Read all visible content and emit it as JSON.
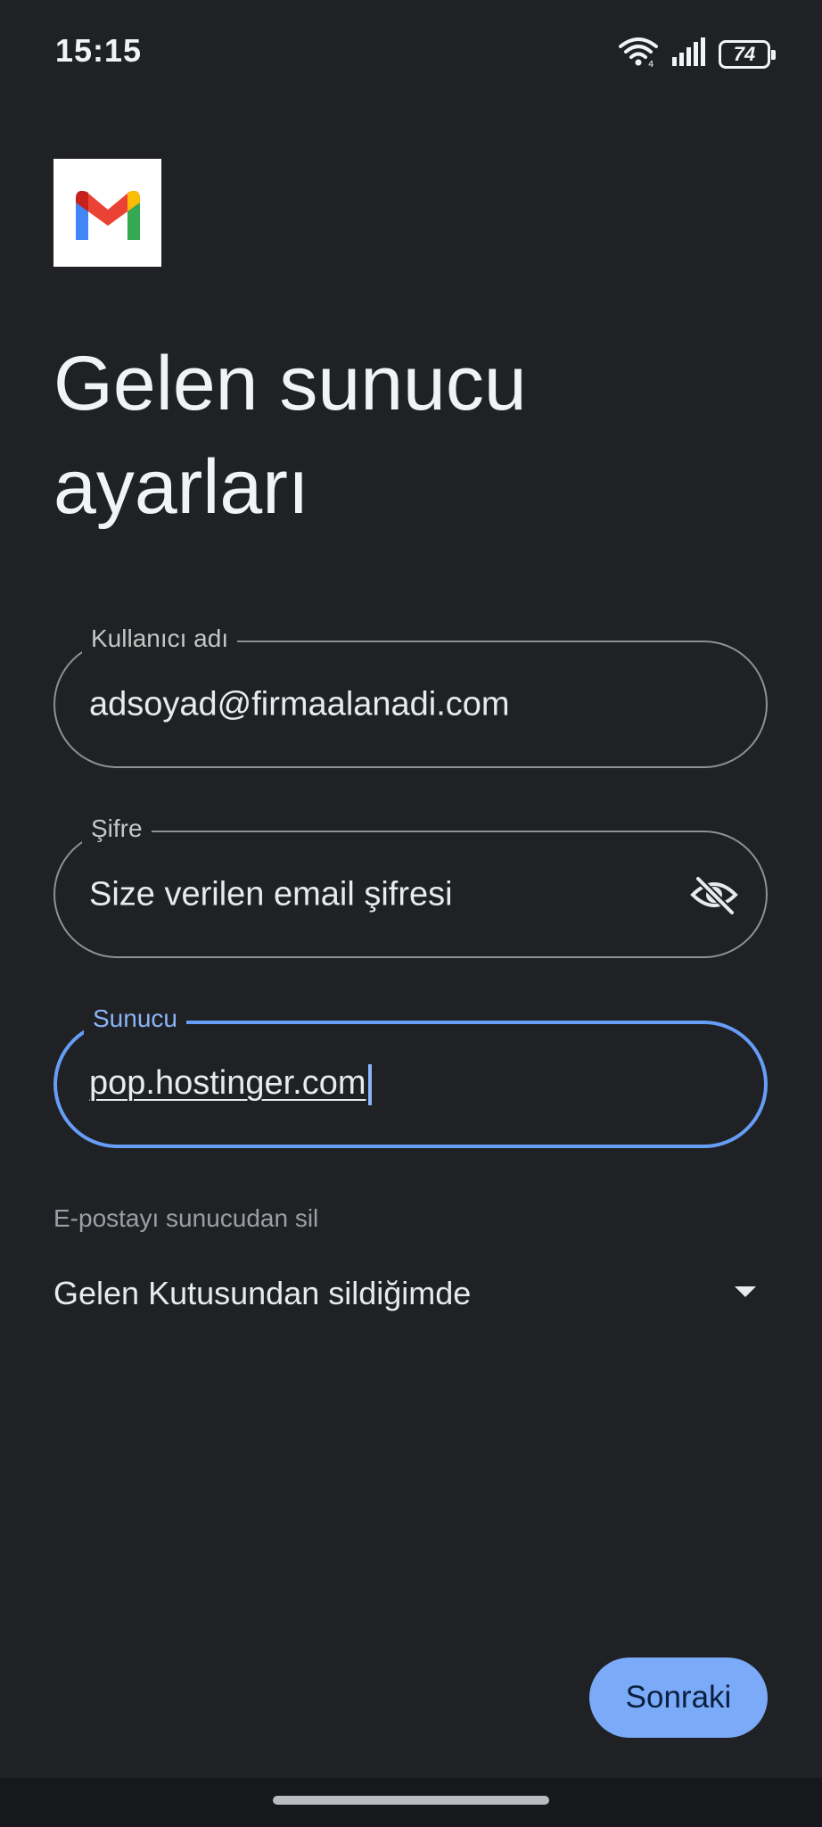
{
  "status_bar": {
    "time": "15:15",
    "battery_level": "74",
    "icons": [
      "wifi-icon",
      "signal-icon",
      "battery-icon"
    ]
  },
  "app": {
    "logo": "gmail-logo"
  },
  "page": {
    "title": "Gelen sunucu ayarları"
  },
  "fields": {
    "username": {
      "label": "Kullanıcı adı",
      "value": "adsoyad@firmaalanadi.com"
    },
    "password": {
      "label": "Şifre",
      "value": "Size verilen email şifresi",
      "toggle_icon": "visibility-off-icon"
    },
    "server": {
      "label": "Sunucu",
      "value": "pop.hostinger.com",
      "focused": true
    }
  },
  "delete_setting": {
    "label": "E-postayı sunucudan sil",
    "selected_value": "Gelen Kutusundan sildiğimde"
  },
  "actions": {
    "next_label": "Sonraki"
  },
  "colors": {
    "background": "#202124",
    "accent": "#8ab4f8",
    "focused_border": "#669df6",
    "outline": "#8e9194"
  }
}
